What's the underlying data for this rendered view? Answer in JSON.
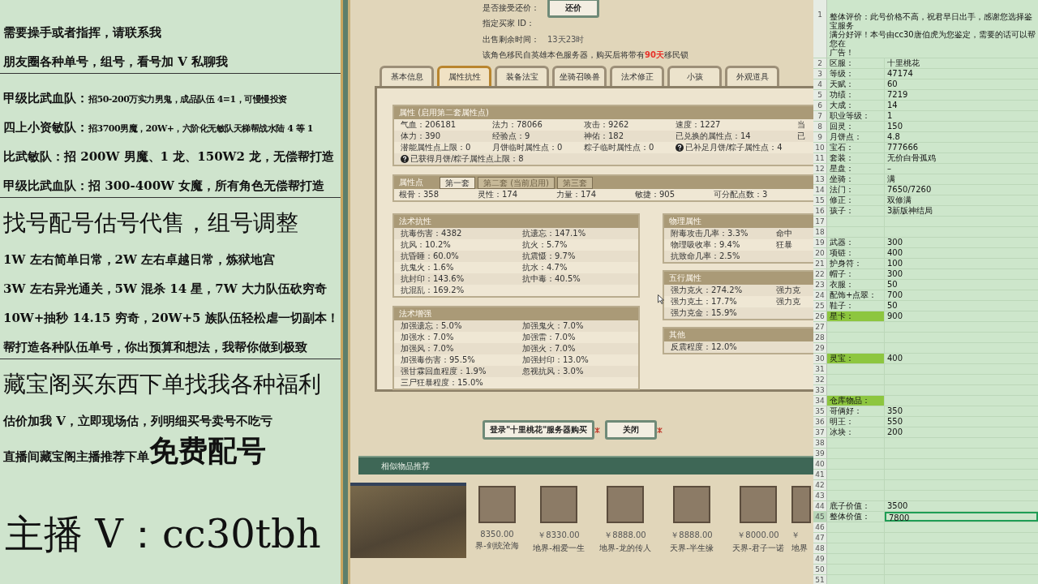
{
  "promo_panel": {
    "lines": [
      {
        "kind": "plain",
        "text": "需要操手或者指挥，请联系我",
        "divider_after": false
      },
      {
        "kind": "plain",
        "text": "朋友圈各种单号，组号，看号加 V 私聊我",
        "divider_after": true
      },
      {
        "kind": "split",
        "lead": "甲级比武血队：",
        "text": "招50-200万实力男鬼，成品队伍 4=1，可慢慢投资",
        "divider_after": false
      },
      {
        "kind": "split",
        "lead": "四上小资敏队：",
        "text": "招3700男魔，20W+，六阶化无敏队天梯帮战水陆 4 等 1",
        "divider_after": false
      },
      {
        "kind": "plain",
        "text": "比武敏队：招 200W 男魔、1 龙、150W2 龙，无偿帮打造",
        "divider_after": false
      },
      {
        "kind": "plain",
        "text": "甲级比武血队：招 300-400W 女魔，所有角色无偿帮打造",
        "divider_after": true
      },
      {
        "kind": "headline",
        "text": "找号配号估号代售，组号调整",
        "divider_after": false
      },
      {
        "kind": "plain",
        "text": "1W 左右简单日常，2W 左右卓越日常，炼狱地宫",
        "divider_after": false
      },
      {
        "kind": "plain",
        "text": "3W 左右异光通关，5W 混杀 14 星，7W 大力队伍砍穷奇",
        "divider_after": false
      },
      {
        "kind": "plain",
        "text": "10W+抽秒 14.15 穷奇，20W+5 族队伍轻松虐一切副本！",
        "divider_after": false
      },
      {
        "kind": "plain",
        "text": "帮打造各种队伍单号，你出预算和想法，我帮你做到极致",
        "divider_after": true
      },
      {
        "kind": "headline",
        "text": "藏宝阁买东西下单找我各种福利",
        "divider_after": false
      },
      {
        "kind": "plain",
        "text": "估价加我 V，立即现场估，列明细买号卖号不吃亏",
        "divider_after": false
      },
      {
        "kind": "emph",
        "text": "直播间藏宝阁主播推荐下单",
        "emph": "免费配号",
        "divider_after": false
      },
      {
        "kind": "contact",
        "text": "主播 V：cc30tbh",
        "divider_after": false
      }
    ]
  },
  "listing": {
    "info": [
      {
        "label": "是否接受还价：",
        "button": "还价"
      },
      {
        "label": "指定买家 ID："
      },
      {
        "label": "出售剩余时间：",
        "value": "13天23时"
      }
    ],
    "notice": {
      "before": "该角色移民自英雄本色服务器，购买后将带有",
      "highlight": "90天",
      "after": "移民锁"
    },
    "tabs": [
      {
        "label": "基本信息",
        "selected": false
      },
      {
        "label": "属性抗性",
        "selected": true
      },
      {
        "label": "装备法宝",
        "selected": false
      },
      {
        "label": "坐骑召唤兽",
        "selected": false
      },
      {
        "label": "法术修正",
        "selected": false
      },
      {
        "label": "小孩",
        "selected": false
      },
      {
        "label": "外观道具",
        "selected": false
      }
    ],
    "attributes": {
      "title": "属性 (启用第二套属性点)",
      "rows": [
        [
          {
            "text": "气血：206181",
            "help": false
          },
          {
            "text": "法力：78066",
            "help": false
          },
          {
            "text": "攻击：9262",
            "help": false
          },
          {
            "text": "速度：1227",
            "help": false
          },
          {
            "text": "当",
            "help": false
          }
        ],
        [
          {
            "text": "体力：390",
            "help": false
          },
          {
            "text": "经验点：9",
            "help": false
          },
          {
            "text": "神佑：182",
            "help": false
          },
          {
            "text": "已兑换的属性点：14",
            "help": false
          },
          {
            "text": "已",
            "help": false
          }
        ],
        [
          {
            "text": "潜能属性点上限：0",
            "help": false
          },
          {
            "text": "月饼临时属性点：0",
            "help": false
          },
          {
            "text": "粽子临时属性点：0",
            "help": false
          },
          {
            "text": "已补足月饼/粽子属性点：4",
            "help": true
          }
        ],
        [
          {
            "text": "已获得月饼/粽子属性点上限：8",
            "help": true
          }
        ]
      ]
    },
    "points": {
      "title": "属性点",
      "sets": [
        {
          "label": "第一套",
          "selected": true
        },
        {
          "label": "第二套 (当前启用)",
          "selected": false
        },
        {
          "label": "第三套",
          "selected": false
        }
      ],
      "values": [
        "根骨：358",
        "灵性：174",
        "力量：174",
        "敏捷：905",
        "可分配点数：3"
      ]
    },
    "left_sections": [
      {
        "title": "法术抗性",
        "rows": [
          [
            "抗毒伤害：4382",
            "抗遗忘：147.1%"
          ],
          [
            "抗风：10.2%",
            "抗火：5.7%"
          ],
          [
            "抗昏睡：60.0%",
            "抗震慑：9.7%"
          ],
          [
            "抗鬼火：1.6%",
            "抗水：4.7%"
          ],
          [
            "抗封印：143.6%",
            "抗中毒：40.5%"
          ],
          [
            "抗混乱：169.2%"
          ]
        ]
      },
      {
        "title": "法术增强",
        "rows": [
          [
            "加强遗忘：5.0%",
            "加强鬼火：7.0%"
          ],
          [
            "加强水：7.0%",
            "加强雷：7.0%"
          ],
          [
            "加强风：7.0%",
            "加强火：7.0%"
          ],
          [
            "加强毒伤害：95.5%",
            "加强封印：13.0%"
          ],
          [
            "强甘霖回血程度：1.9%",
            "忽视抗风：3.0%"
          ],
          [
            "三尸狂暴程度：15.0%"
          ]
        ]
      }
    ],
    "right_sections": [
      {
        "title": "物理属性",
        "rows": [
          [
            "附毒攻击几率：3.3%",
            "命中"
          ],
          [
            "物理吸收率：9.4%",
            "狂暴"
          ],
          [
            "抗致命几率：2.5%"
          ]
        ]
      },
      {
        "title": "五行属性",
        "rows": [
          [
            "强力克火：274.2%",
            "强力克"
          ],
          [
            "强力克土：17.7%",
            "强力克"
          ],
          [
            "强力克金：15.9%"
          ]
        ]
      },
      {
        "title": "其他",
        "rows": [
          [
            "反震程度：12.0%"
          ]
        ]
      }
    ],
    "buttons": [
      "登录\"十里桃花\"服务器购买",
      "关闭"
    ],
    "similar": {
      "title": "相似物品推荐",
      "items": [
        {
          "price": "8350.00",
          "name": "界-剑统沧海"
        },
        {
          "price": "￥8330.00",
          "name": "地界-相爱一生"
        },
        {
          "price": "￥8888.00",
          "name": "地界-龙的传人"
        },
        {
          "price": "￥8888.00",
          "name": "天界-半生缘"
        },
        {
          "price": "￥8000.00",
          "name": "天界-君子一诺"
        },
        {
          "price": "￥",
          "name": "地界"
        }
      ]
    }
  },
  "sheet": {
    "rows": [
      {
        "num": "1",
        "label": "整体评价：此号价格不高，祝君早日出手，感谢您选择鉴宝服务",
        "label2": "满分好评！本号由cc30唐伯虎为您鉴定，需要的话可以帮您在",
        "label3": "广告！",
        "highlighted": false,
        "selected": false
      },
      {
        "num": "2",
        "label": "区服：",
        "value": "十里桃花",
        "highlighted": false,
        "selected": false
      },
      {
        "num": "3",
        "label": "等级：",
        "value": "47174",
        "highlighted": false,
        "selected": false
      },
      {
        "num": "4",
        "label": "天赋：",
        "value": "60",
        "highlighted": false,
        "selected": false
      },
      {
        "num": "5",
        "label": "功绩：",
        "value": "7219",
        "highlighted": false,
        "selected": false
      },
      {
        "num": "6",
        "label": "大成：",
        "value": "14",
        "highlighted": false,
        "selected": false
      },
      {
        "num": "7",
        "label": "职业等级：",
        "value": "1",
        "highlighted": false,
        "selected": false
      },
      {
        "num": "8",
        "label": "回灵：",
        "value": "150",
        "highlighted": false,
        "selected": false
      },
      {
        "num": "9",
        "label": "月饼点：",
        "value": "4.8",
        "highlighted": false,
        "selected": false
      },
      {
        "num": "10",
        "label": "宝石：",
        "value": "777666",
        "highlighted": false,
        "selected": false
      },
      {
        "num": "11",
        "label": "套装：",
        "value": "无价白骨孤鸡",
        "highlighted": false,
        "selected": false
      },
      {
        "num": "12",
        "label": "星盘：",
        "value": "–",
        "highlighted": false,
        "selected": false
      },
      {
        "num": "13",
        "label": "坐骑：",
        "value": "满",
        "highlighted": false,
        "selected": false
      },
      {
        "num": "14",
        "label": "法门：",
        "value": "7650/7260",
        "highlighted": false,
        "selected": false
      },
      {
        "num": "15",
        "label": "修正：",
        "value": "双修满",
        "highlighted": false,
        "selected": false
      },
      {
        "num": "16",
        "label": "孩子：",
        "value": "3新版神结局",
        "highlighted": false,
        "selected": false
      },
      {
        "num": "17",
        "highlighted": false,
        "selected": false
      },
      {
        "num": "18",
        "highlighted": false,
        "selected": false
      },
      {
        "num": "19",
        "label": "武器：",
        "value": "300",
        "highlighted": false,
        "selected": false
      },
      {
        "num": "20",
        "label": "项链：",
        "value": "400",
        "highlighted": false,
        "selected": false
      },
      {
        "num": "21",
        "label": "护身符：",
        "value": "100",
        "highlighted": false,
        "selected": false
      },
      {
        "num": "22",
        "label": "帽子：",
        "value": "300",
        "highlighted": false,
        "selected": false
      },
      {
        "num": "23",
        "label": "衣服：",
        "value": "50",
        "highlighted": false,
        "selected": false
      },
      {
        "num": "24",
        "label": "配饰+点翠：",
        "value": "700",
        "highlighted": false,
        "selected": false
      },
      {
        "num": "25",
        "label": "鞋子：",
        "value": "50",
        "highlighted": false,
        "selected": false
      },
      {
        "num": "26",
        "label": "星卡：",
        "value": "900",
        "highlighted": true,
        "selected": false
      },
      {
        "num": "27",
        "highlighted": false,
        "selected": false
      },
      {
        "num": "28",
        "highlighted": false,
        "selected": false
      },
      {
        "num": "29",
        "highlighted": false,
        "selected": false
      },
      {
        "num": "30",
        "label": "灵宝：",
        "value": "400",
        "highlighted": true,
        "selected": false
      },
      {
        "num": "31",
        "highlighted": false,
        "selected": false
      },
      {
        "num": "32",
        "highlighted": false,
        "selected": false
      },
      {
        "num": "33",
        "highlighted": false,
        "selected": false
      },
      {
        "num": "34",
        "label": "仓库物品：",
        "highlighted": true,
        "selected": false
      },
      {
        "num": "35",
        "label": "哥俩好：",
        "value": "350",
        "highlighted": false,
        "selected": false
      },
      {
        "num": "36",
        "label": "明王：",
        "value": "550",
        "highlighted": false,
        "selected": false
      },
      {
        "num": "37",
        "label": "冰块：",
        "value": "200",
        "highlighted": false,
        "selected": false
      },
      {
        "num": "38",
        "highlighted": false,
        "selected": false
      },
      {
        "num": "39",
        "highlighted": false,
        "selected": false
      },
      {
        "num": "40",
        "highlighted": false,
        "selected": false
      },
      {
        "num": "41",
        "highlighted": false,
        "selected": false
      },
      {
        "num": "42",
        "highlighted": false,
        "selected": false
      },
      {
        "num": "43",
        "highlighted": false,
        "selected": false
      },
      {
        "num": "44",
        "label": "底子价值：",
        "value": "3500",
        "highlighted": false,
        "selected": false
      },
      {
        "num": "45",
        "label": "整体价值：",
        "value": "7800",
        "highlighted": false,
        "selected": true
      },
      {
        "num": "46",
        "highlighted": false,
        "selected": false
      },
      {
        "num": "47",
        "highlighted": false,
        "selected": false
      },
      {
        "num": "48",
        "highlighted": false,
        "selected": false
      },
      {
        "num": "49",
        "highlighted": false,
        "selected": false
      },
      {
        "num": "50",
        "highlighted": false,
        "selected": false
      },
      {
        "num": "51",
        "highlighted": false,
        "selected": false
      }
    ]
  }
}
